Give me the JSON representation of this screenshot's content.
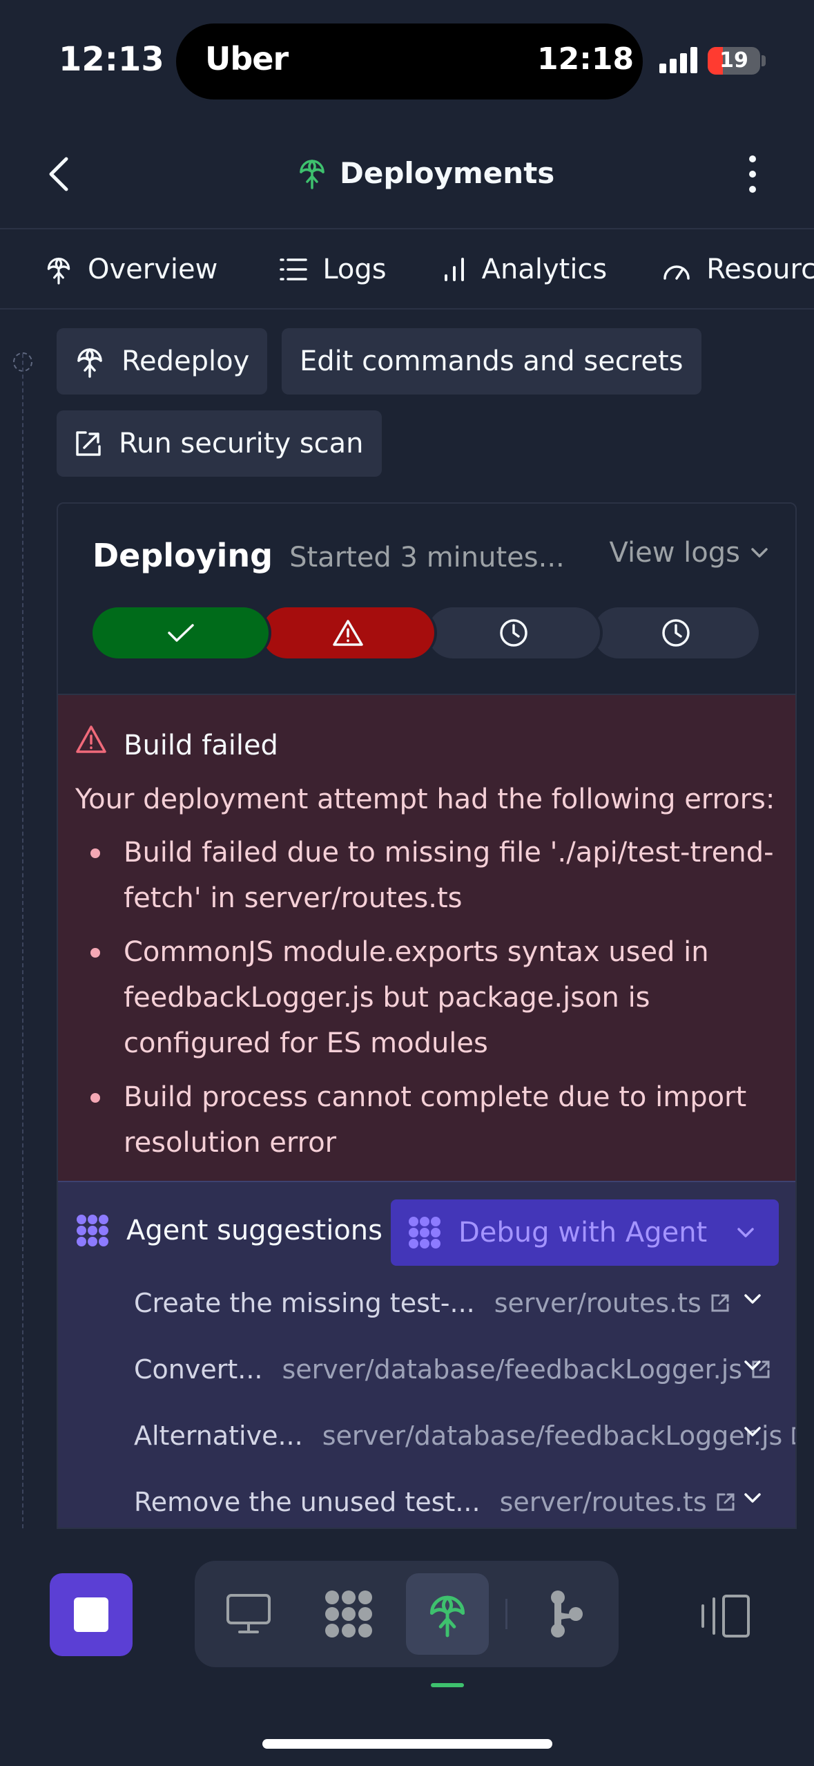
{
  "status_bar": {
    "time": "12:13",
    "island_app": "Uber",
    "island_time": "12:18",
    "battery": "19"
  },
  "header": {
    "title": "Deployments"
  },
  "tabs": [
    {
      "label": "Overview",
      "icon": "deploy-icon",
      "active": true
    },
    {
      "label": "Logs",
      "icon": "list-icon"
    },
    {
      "label": "Analytics",
      "icon": "bar-chart-icon"
    },
    {
      "label": "Resources",
      "icon": "gauge-icon"
    }
  ],
  "actions": {
    "redeploy": "Redeploy",
    "edit_commands": "Edit commands and secrets",
    "security_scan": "Run security scan"
  },
  "deployment": {
    "status": "Deploying",
    "started": "Started 3 minutes...",
    "view_logs": "View logs",
    "steps": [
      "success",
      "error",
      "pending",
      "pending"
    ]
  },
  "error": {
    "title": "Build failed",
    "intro": "Your deployment attempt had the following errors:",
    "items": [
      "Build failed due to missing file './api/test-trend-fetch' in server/routes.ts",
      "CommonJS module.exports syntax used in feedbackLogger.js but package.json is configured for ES modules",
      "Build process cannot complete due to import resolution error"
    ]
  },
  "agent": {
    "label": "Agent suggestions",
    "debug_button": "Debug with Agent",
    "suggestions": [
      {
        "title": "Create the missing test-...",
        "file": "server/routes.ts"
      },
      {
        "title": "Convert...",
        "file": "server/database/feedbackLogger.js"
      },
      {
        "title": "Alternative...",
        "file": "server/database/feedbackLogger.js"
      },
      {
        "title": "Remove the unused test...",
        "file": "server/routes.ts"
      }
    ]
  },
  "colors": {
    "background": "#1c2333",
    "success": "#006b1a",
    "error": "#a60d0d",
    "accent": "#5b3fd4",
    "agent_text": "#a494ff"
  },
  "dock": {
    "items": [
      "preview-icon",
      "agent-icon",
      "deploy-icon",
      "git-icon"
    ],
    "active": "deploy-icon"
  }
}
